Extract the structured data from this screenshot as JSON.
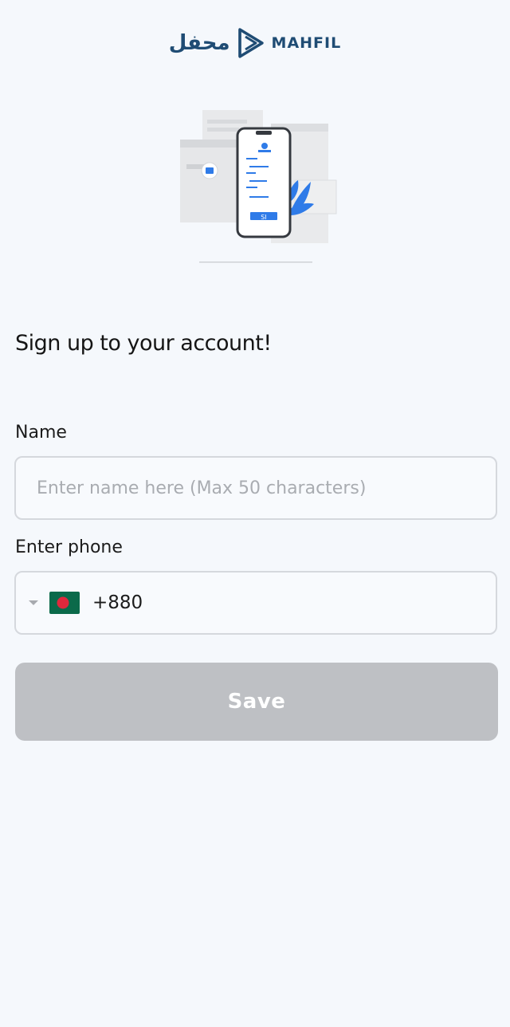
{
  "brand": {
    "name_arabic": "محفل",
    "name_latin": "MAHFIL",
    "color": "#1f4c74"
  },
  "illustration": {
    "icon": "phone-signup-illustration-icon",
    "phone_button_text": "SI"
  },
  "form": {
    "title": "Sign up to your account!",
    "name_label": "Name",
    "name_placeholder": "Enter name here (Max 50 characters)",
    "name_value": "",
    "phone_label": "Enter phone",
    "country_flag_icon": "bangladesh-flag-icon",
    "dial_code": "+880",
    "save_label": "Save"
  },
  "colors": {
    "background": "#f5f8fc",
    "button_disabled": "#bec0c4",
    "accent_blue": "#2f7be8"
  }
}
